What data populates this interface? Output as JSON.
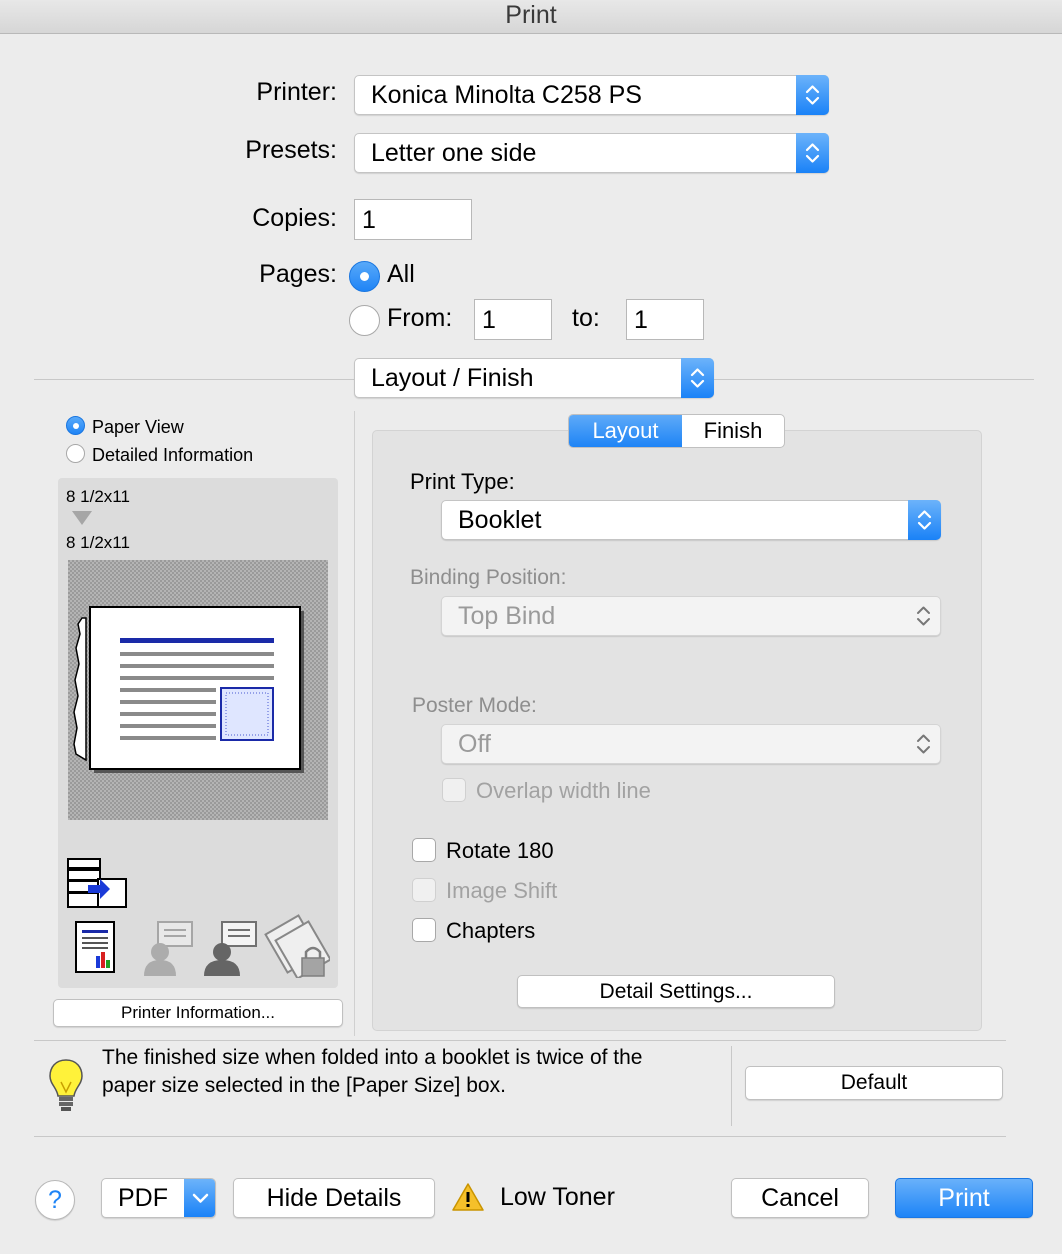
{
  "window": {
    "title": "Print"
  },
  "printer": {
    "label": "Printer:",
    "value": "Konica Minolta C258 PS"
  },
  "presets": {
    "label": "Presets:",
    "value": "Letter one side"
  },
  "copies": {
    "label": "Copies:",
    "value": "1"
  },
  "pages": {
    "label": "Pages:",
    "all_label": "All",
    "all_selected": true,
    "from_label": "From:",
    "from_value": "1",
    "to_label": "to:",
    "to_value": "1"
  },
  "section_popup": {
    "value": "Layout / Finish"
  },
  "preview": {
    "paper_view_label": "Paper View",
    "paper_view_selected": true,
    "detailed_info_label": "Detailed Information",
    "source_size": "8 1/2x11",
    "output_size": "8 1/2x11",
    "printer_info_button": "Printer Information..."
  },
  "tabs": {
    "layout": "Layout",
    "finish": "Finish",
    "active": "Layout"
  },
  "layout_panel": {
    "print_type_label": "Print Type:",
    "print_type_value": "Booklet",
    "binding_position_label": "Binding Position:",
    "binding_position_value": "Top Bind",
    "poster_mode_label": "Poster Mode:",
    "poster_mode_value": "Off",
    "overlap_label": "Overlap width line",
    "rotate_label": "Rotate 180",
    "image_shift_label": "Image Shift",
    "chapters_label": "Chapters",
    "detail_settings_button": "Detail Settings..."
  },
  "hint": {
    "text_line1": "The finished size when folded into a booklet is twice of the",
    "text_line2": "paper size selected in the [Paper Size] box.",
    "default_button": "Default"
  },
  "footer": {
    "help": "?",
    "pdf": "PDF",
    "hide_details": "Hide Details",
    "warning": "Low Toner",
    "cancel": "Cancel",
    "print": "Print"
  },
  "colors": {
    "accent": "#1e84f6",
    "background": "#ececec"
  }
}
